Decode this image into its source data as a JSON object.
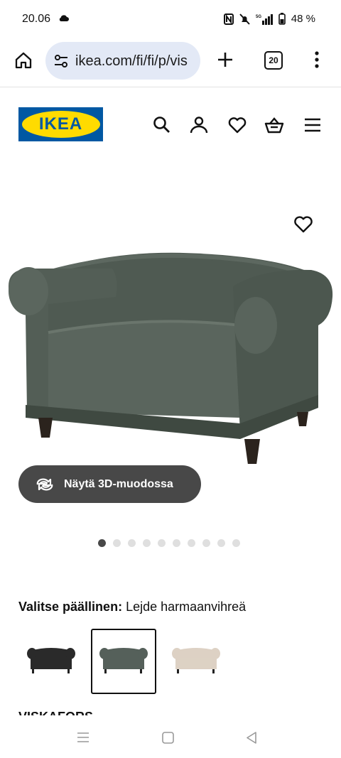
{
  "status": {
    "time": "20.06",
    "battery": "48 %",
    "network": "5G"
  },
  "browser": {
    "url": "ikea.com/fi/fi/p/vis",
    "tab_count": "20"
  },
  "site": {
    "logo_text": "IKEA"
  },
  "product": {
    "view_3d_label": "Näytä 3D-muodossa",
    "image_count": 10,
    "active_image": 1,
    "cover_label_prefix": "Valitse päällinen:",
    "cover_selected": "Lejde harmaanvihreä",
    "swatches": [
      {
        "name": "black",
        "color": "#2a2a2a"
      },
      {
        "name": "grey-green",
        "color": "#55605a"
      },
      {
        "name": "beige",
        "color": "#ddd1c4"
      }
    ],
    "cut_text": "VISKAFORS"
  },
  "colors": {
    "accent_dark": "#484848",
    "url_bg": "#e3e9f6",
    "ikea_blue": "#0058a3",
    "ikea_yellow": "#ffdb00"
  }
}
